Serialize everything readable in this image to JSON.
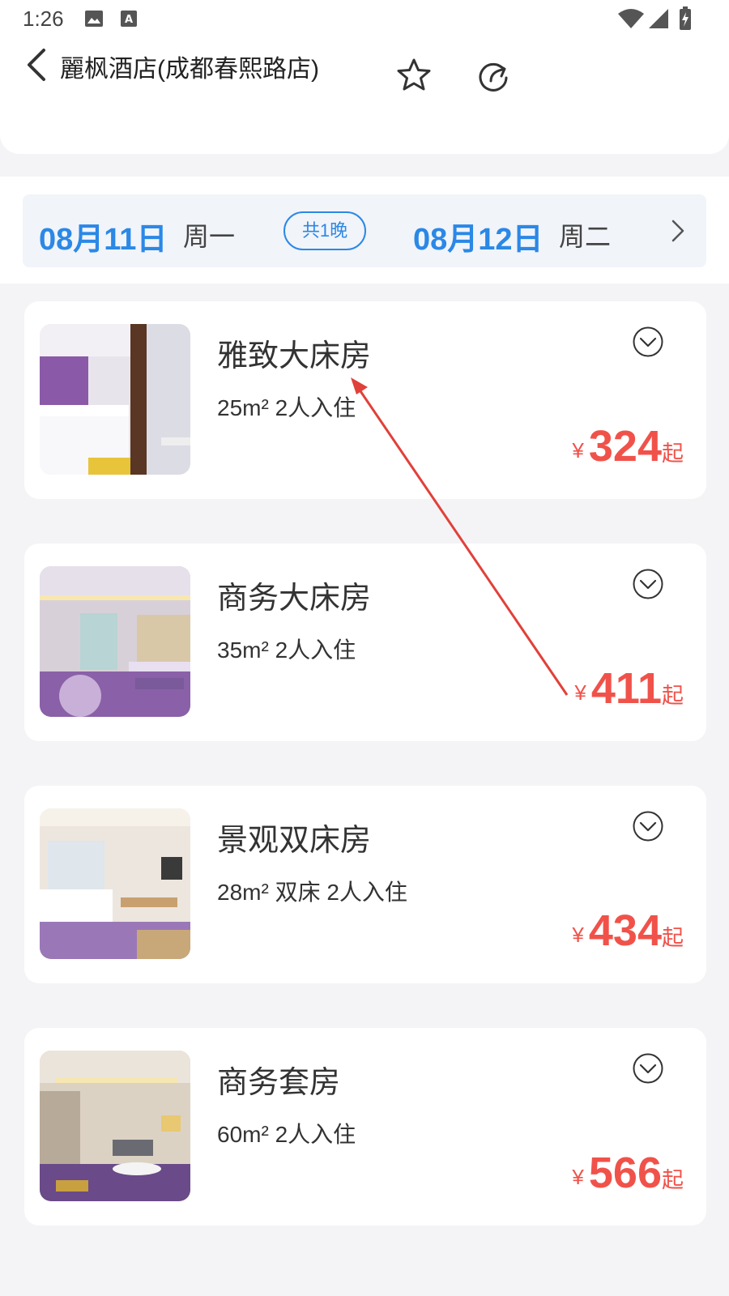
{
  "status_bar": {
    "time": "1:26"
  },
  "header": {
    "hotel_name": "麗枫酒店(成都春熙路店)",
    "icons": [
      "back-icon",
      "star-icon",
      "share-icon"
    ]
  },
  "date_bar": {
    "checkin_date": "08月11日",
    "checkin_weekday": "周一",
    "nights": "共1晚",
    "checkout_date": "08月12日",
    "checkout_weekday": "周二"
  },
  "rooms": [
    {
      "name": "雅致大床房",
      "spec": "25m² 2人入住",
      "currency": "¥",
      "price": "324",
      "suffix": "起"
    },
    {
      "name": "商务大床房",
      "spec": "35m² 2人入住",
      "currency": "¥",
      "price": "411",
      "suffix": "起"
    },
    {
      "name": "景观双床房",
      "spec": "28m² 双床 2人入住",
      "currency": "¥",
      "price": "434",
      "suffix": "起"
    },
    {
      "name": "商务套房",
      "spec": "60m² 2人入住",
      "currency": "¥",
      "price": "566",
      "suffix": "起"
    }
  ],
  "colors": {
    "accent_blue": "#2b88e6",
    "price_red": "#f0524a",
    "annotation_red": "#e0413a"
  }
}
